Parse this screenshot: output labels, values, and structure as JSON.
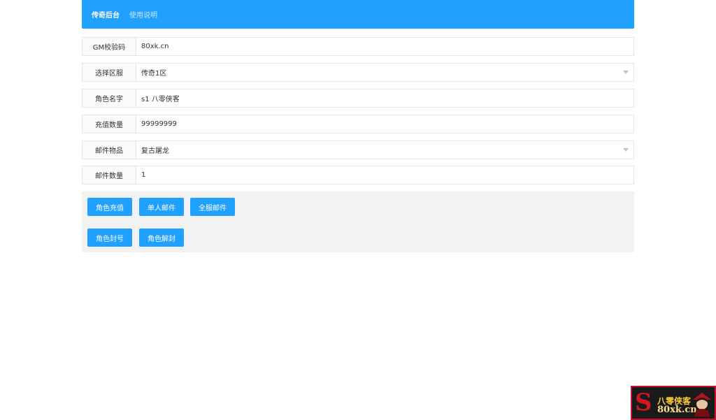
{
  "header": {
    "brand": "传奇后台",
    "help": "使用说明"
  },
  "form": [
    {
      "key": "gm_code",
      "label": "GM校验码",
      "value": "80xk.cn",
      "type": "input"
    },
    {
      "key": "server",
      "label": "选择区服",
      "value": "传奇1区",
      "type": "select"
    },
    {
      "key": "role_name",
      "label": "角色名字",
      "value": "s1 八零侠客",
      "type": "input"
    },
    {
      "key": "recharge",
      "label": "充值数量",
      "value": "99999999",
      "type": "input"
    },
    {
      "key": "mail_item",
      "label": "邮件物品",
      "value": "复古屠龙",
      "type": "select"
    },
    {
      "key": "mail_count",
      "label": "邮件数量",
      "value": "1",
      "type": "input"
    }
  ],
  "buttons": {
    "recharge": "角色充值",
    "single_mail": "单人邮件",
    "all_mail": "全服邮件",
    "ban": "角色封号",
    "unban": "角色解封"
  },
  "watermark": {
    "line1": "八零侠客",
    "line2": "80xk.cn",
    "mark": "S"
  },
  "colors": {
    "primary": "#20a0ff",
    "panel": "#f2f2f2",
    "border": "#e6e6e6"
  }
}
